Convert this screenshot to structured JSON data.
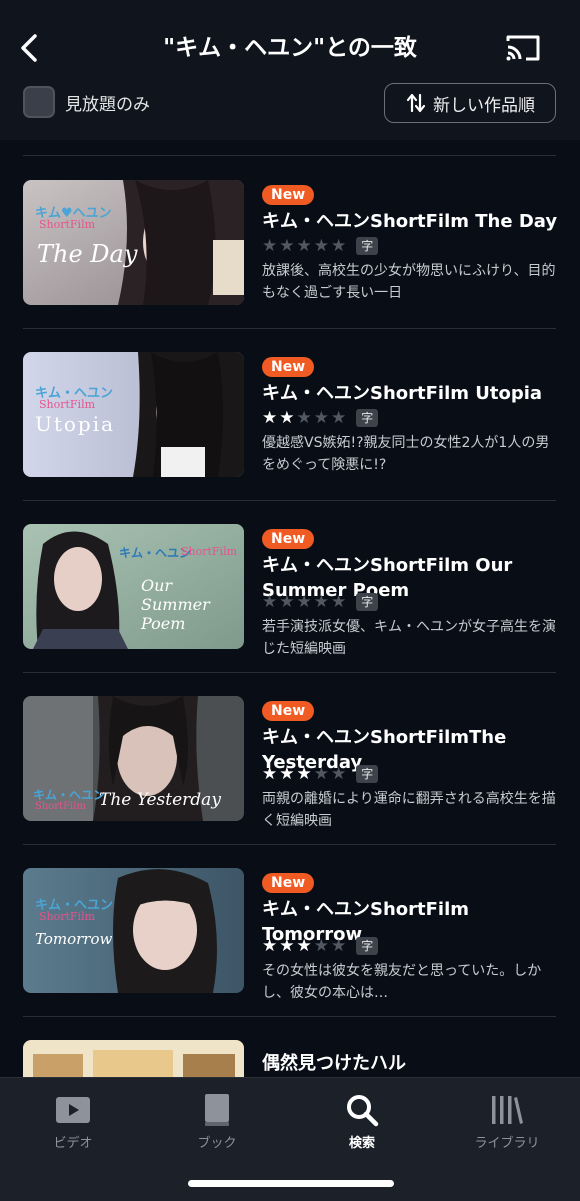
{
  "header": {
    "title": "\"キム・ヘユン\"との一致",
    "back_icon": "chevron-left-icon",
    "cast_icon": "cast-icon",
    "filter_label": "見放題のみ",
    "filter_checked": false,
    "sort_label": "新しい作品順",
    "sort_icon": "sort-arrows-icon"
  },
  "colors": {
    "accent": "#f05a23",
    "background": "#090d16"
  },
  "results": [
    {
      "badge": "New",
      "title": "キム・ヘユンShortFilm The Day",
      "rating": 0,
      "sub": "字",
      "description": "放課後、高校生の少女が物思いにふけり、目的もなく過ごす長い一日",
      "thumb": {
        "logo": "キム♥ヘユン",
        "logo_sub": "ShortFilm",
        "caption": "The Day"
      }
    },
    {
      "badge": "New",
      "title": "キム・ヘユンShortFilm Utopia",
      "rating": 2,
      "sub": "字",
      "description": "優越感VS嫉妬!?親友同士の女性2人が1人の男をめぐって険悪に!?",
      "thumb": {
        "logo": "キム・ヘユン",
        "logo_sub": "ShortFilm",
        "caption": "Utopia"
      }
    },
    {
      "badge": "New",
      "title": "キム・ヘユンShortFilm Our Summer Poem",
      "rating": 0,
      "sub": "字",
      "description": "若手演技派女優、キム・ヘユンが女子高生を演じた短編映画",
      "thumb": {
        "logo": "キム・ヘユン",
        "logo_sub": "ShortFilm",
        "caption": "Our Summer Poem"
      }
    },
    {
      "badge": "New",
      "title": "キム・ヘユンShortFilmThe Yesterday",
      "rating": 3,
      "sub": "字",
      "description": "両親の離婚により運命に翻弄される高校生を描く短編映画",
      "thumb": {
        "logo": "キム・ヘユン",
        "logo_sub": "ShortFilm",
        "caption": "The Yesterday"
      }
    },
    {
      "badge": "New",
      "title": "キム・ヘユンShortFilm Tomorrow",
      "rating": 3,
      "sub": "字",
      "description": "その女性は彼女を親友だと思っていた。しかし、彼女の本心は…",
      "thumb": {
        "logo": "キム・ヘユン",
        "logo_sub": "ShortFilm",
        "caption": "Tomorrow"
      }
    },
    {
      "title": "偶然見つけたハル"
    }
  ],
  "tabbar": {
    "tabs": [
      {
        "label": "ビデオ",
        "icon": "play-icon",
        "active": false
      },
      {
        "label": "ブック",
        "icon": "book-icon",
        "active": false
      },
      {
        "label": "検索",
        "icon": "search-icon",
        "active": true
      },
      {
        "label": "ライブラリ",
        "icon": "library-icon",
        "active": false
      }
    ]
  }
}
